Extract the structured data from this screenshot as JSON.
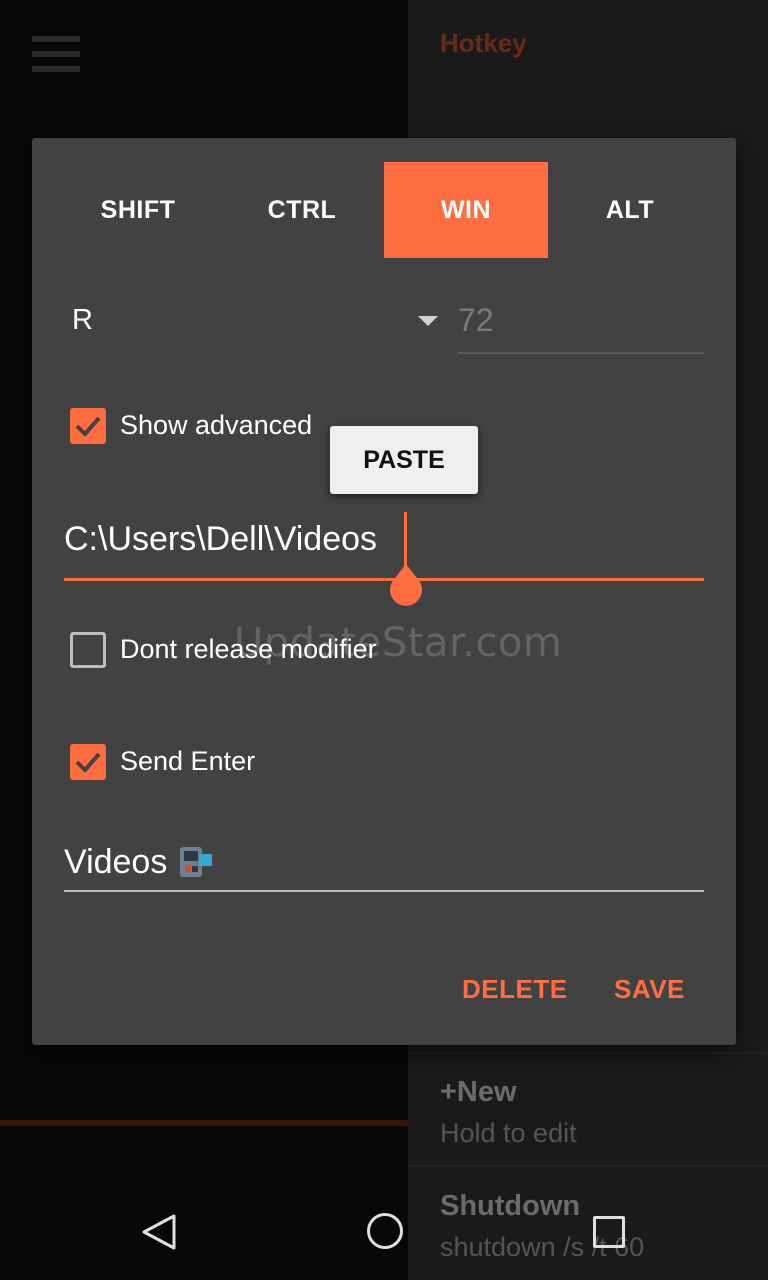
{
  "background": {
    "title": "Hotkey",
    "items": [
      {
        "title": "+New",
        "subtitle": "Hold to edit"
      },
      {
        "title": "Shutdown",
        "subtitle": "shutdown /s /t 60"
      }
    ]
  },
  "dialog": {
    "modifiers": [
      {
        "label": "SHIFT",
        "active": false
      },
      {
        "label": "CTRL",
        "active": false
      },
      {
        "label": "WIN",
        "active": true
      },
      {
        "label": "ALT",
        "active": false
      }
    ],
    "key_spinner": {
      "value": "R"
    },
    "key_code": {
      "value": "72"
    },
    "show_advanced": {
      "label": "Show advanced",
      "checked": true
    },
    "paste_popup": {
      "label": "PASTE"
    },
    "command_field": {
      "value": "C:\\Users\\Dell\\Videos"
    },
    "dont_release_modifier": {
      "label": "Dont release modifier",
      "checked": false
    },
    "send_enter": {
      "label": "Send Enter",
      "checked": true
    },
    "name_field": {
      "value": "Videos"
    },
    "actions": {
      "delete": "DELETE",
      "save": "SAVE"
    }
  },
  "watermark": "UpdateStar.com",
  "colors": {
    "accent": "#ff6e40",
    "dialog_bg": "#424242",
    "text": "#ffffff"
  }
}
